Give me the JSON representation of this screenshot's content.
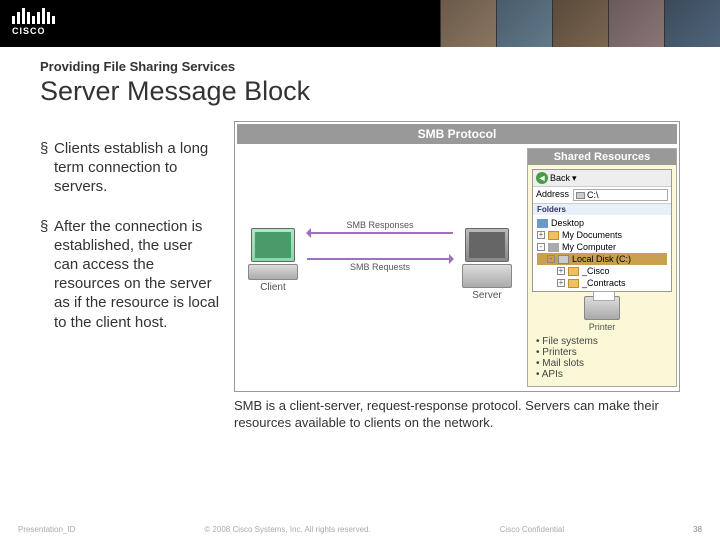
{
  "header": {
    "logo_text": "CISCO"
  },
  "slide": {
    "kicker": "Providing File Sharing Services",
    "title": "Server Message Block",
    "bullets": [
      "Clients establish a long term connection to servers.",
      "After the connection is established, the user can access the resources on the server as if the resource is local to the client host."
    ],
    "caption": "SMB is a client-server, request-response protocol. Servers can make their resources available to clients on the network."
  },
  "diagram": {
    "title": "SMB Protocol",
    "client_label": "Client",
    "server_label": "Server",
    "arrow_responses": "SMB Responses",
    "arrow_requests": "SMB Requests",
    "shared_title": "Shared Resources",
    "explorer": {
      "back": "Back",
      "address_label": "Address",
      "address_value": "C:\\",
      "section": "Folders",
      "items": {
        "desktop": "Desktop",
        "mydocs": "My Documents",
        "mycomp": "My Computer",
        "localdisk": "Local Disk (C:)",
        "cisco": "_Cisco",
        "contracts": "_Contracts"
      }
    },
    "printer_label": "Printer",
    "resources": [
      "File systems",
      "Printers",
      "Mail slots",
      "APIs"
    ]
  },
  "footer": {
    "left": "Presentation_ID",
    "center": "© 2008 Cisco Systems, Inc. All rights reserved.",
    "confidential": "Cisco Confidential",
    "page": "38"
  }
}
